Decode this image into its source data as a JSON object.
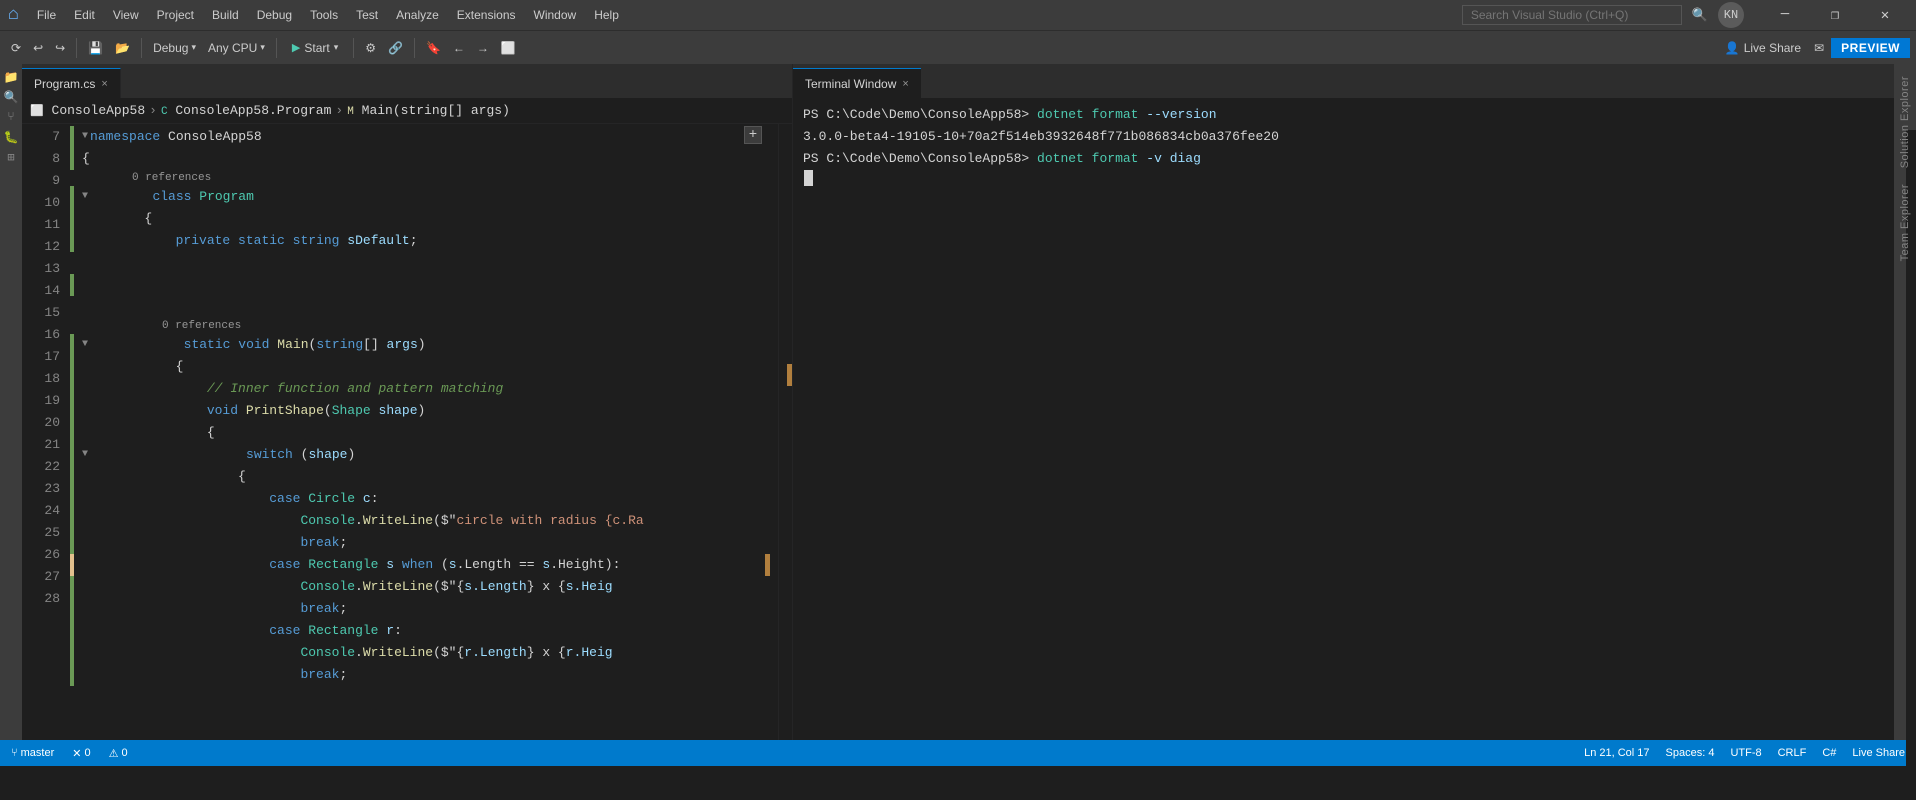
{
  "titlebar": {
    "logo": "⌂",
    "menu_items": [
      "File",
      "Edit",
      "View",
      "Project",
      "Build",
      "Debug",
      "Tools",
      "Test",
      "Analyze",
      "Extensions",
      "Window",
      "Help"
    ],
    "search_placeholder": "Search Visual Studio (Ctrl+Q)",
    "avatar_label": "KN",
    "minimize_label": "─",
    "restore_label": "❐",
    "close_label": "✕"
  },
  "toolbar": {
    "debug_label": "Debug",
    "cpu_label": "Any CPU",
    "start_label": "Start",
    "live_share_label": "Live Share",
    "preview_label": "PREVIEW"
  },
  "editor_tab": {
    "label": "Program.cs",
    "close_label": "×"
  },
  "breadcrumb": {
    "project": "ConsoleApp58",
    "class": "ConsoleApp58.Program",
    "method": "Main(string[] args)"
  },
  "code_lines": [
    {
      "num": "7",
      "indent": 0,
      "fold": "▼",
      "content": "namespace ConsoleApp58",
      "tokens": [
        {
          "t": "kw",
          "v": "namespace"
        },
        {
          "t": "plain",
          "v": " ConsoleApp58"
        }
      ],
      "lm": "green"
    },
    {
      "num": "8",
      "indent": 0,
      "fold": null,
      "content": "{",
      "tokens": [
        {
          "t": "plain",
          "v": "{"
        }
      ],
      "lm": "green"
    },
    {
      "num": "9",
      "indent": 1,
      "fold": "▼",
      "ref": "0 references",
      "content": "        class Program",
      "tokens": [
        {
          "t": "plain",
          "v": "        "
        },
        {
          "t": "kw",
          "v": "class"
        },
        {
          "t": "plain",
          "v": " "
        },
        {
          "t": "cls",
          "v": "Program"
        }
      ],
      "lm": "green"
    },
    {
      "num": "10",
      "indent": 1,
      "fold": null,
      "content": "        {",
      "tokens": [
        {
          "t": "plain",
          "v": "        {"
        }
      ],
      "lm": "green"
    },
    {
      "num": "11",
      "indent": 2,
      "fold": null,
      "content": "            private static string sDefault;",
      "tokens": [
        {
          "t": "plain",
          "v": "            "
        },
        {
          "t": "kw",
          "v": "private"
        },
        {
          "t": "plain",
          "v": " "
        },
        {
          "t": "kw",
          "v": "static"
        },
        {
          "t": "plain",
          "v": " "
        },
        {
          "t": "kw",
          "v": "string"
        },
        {
          "t": "plain",
          "v": " "
        },
        {
          "t": "var",
          "v": "sDefault"
        },
        {
          "t": "plain",
          "v": ";"
        }
      ],
      "lm": "green"
    },
    {
      "num": "12",
      "indent": 2,
      "fold": null,
      "content": "",
      "tokens": [],
      "lm": "green"
    },
    {
      "num": "13",
      "indent": 2,
      "fold": "▼",
      "ref": "0 references",
      "content": "            static void Main(string[] args)",
      "tokens": [
        {
          "t": "plain",
          "v": "            "
        },
        {
          "t": "kw",
          "v": "static"
        },
        {
          "t": "plain",
          "v": " "
        },
        {
          "t": "kw",
          "v": "void"
        },
        {
          "t": "plain",
          "v": " "
        },
        {
          "t": "method",
          "v": "Main"
        },
        {
          "t": "plain",
          "v": "("
        },
        {
          "t": "kw",
          "v": "string"
        },
        {
          "t": "plain",
          "v": "[] "
        },
        {
          "t": "param",
          "v": "args"
        },
        {
          "t": "plain",
          "v": ")"
        }
      ],
      "lm": "green"
    },
    {
      "num": "14",
      "indent": 2,
      "fold": null,
      "content": "            {",
      "tokens": [
        {
          "t": "plain",
          "v": "            {"
        }
      ],
      "lm": "green"
    },
    {
      "num": "15",
      "indent": 3,
      "fold": null,
      "content": "                // Inner function and pattern matching",
      "tokens": [
        {
          "t": "comment",
          "v": "                // Inner function and pattern matching"
        }
      ],
      "lm": "green"
    },
    {
      "num": "16",
      "indent": 3,
      "fold": null,
      "content": "                void PrintShape(Shape shape)",
      "tokens": [
        {
          "t": "plain",
          "v": "                "
        },
        {
          "t": "kw",
          "v": "void"
        },
        {
          "t": "plain",
          "v": " "
        },
        {
          "t": "method",
          "v": "PrintShape"
        },
        {
          "t": "plain",
          "v": "("
        },
        {
          "t": "cls",
          "v": "Shape"
        },
        {
          "t": "plain",
          "v": " "
        },
        {
          "t": "param",
          "v": "shape"
        },
        {
          "t": "plain",
          "v": ")"
        }
      ],
      "lm": "green"
    },
    {
      "num": "17",
      "indent": 3,
      "fold": null,
      "content": "                {",
      "tokens": [
        {
          "t": "plain",
          "v": "                {"
        }
      ],
      "lm": "green"
    },
    {
      "num": "18",
      "indent": 4,
      "fold": "▼",
      "content": "                    switch (shape)",
      "tokens": [
        {
          "t": "plain",
          "v": "                    "
        },
        {
          "t": "kw",
          "v": "switch"
        },
        {
          "t": "plain",
          "v": " ("
        },
        {
          "t": "param",
          "v": "shape"
        },
        {
          "t": "plain",
          "v": ")"
        }
      ],
      "lm": "green"
    },
    {
      "num": "19",
      "indent": 4,
      "fold": null,
      "content": "                    {",
      "tokens": [
        {
          "t": "plain",
          "v": "                    {"
        }
      ],
      "lm": "green"
    },
    {
      "num": "20",
      "indent": 5,
      "fold": null,
      "content": "                        case Circle c:",
      "tokens": [
        {
          "t": "plain",
          "v": "                        "
        },
        {
          "t": "kw",
          "v": "case"
        },
        {
          "t": "plain",
          "v": " "
        },
        {
          "t": "cls",
          "v": "Circle"
        },
        {
          "t": "plain",
          "v": " "
        },
        {
          "t": "var",
          "v": "c"
        },
        {
          "t": "plain",
          "v": ":"
        }
      ],
      "lm": "green"
    },
    {
      "num": "21",
      "indent": 6,
      "fold": null,
      "content": "                            Console.WriteLine($\"circle with radius {c.Ra",
      "tokens": [
        {
          "t": "plain",
          "v": "                            "
        },
        {
          "t": "cls",
          "v": "Console"
        },
        {
          "t": "plain",
          "v": "."
        },
        {
          "t": "method",
          "v": "WriteLine"
        },
        {
          "t": "plain",
          "v": "($\""
        },
        {
          "t": "str",
          "v": "circle with radius {c.Ra"
        }
      ],
      "lm": "green"
    },
    {
      "num": "22",
      "indent": 6,
      "fold": null,
      "content": "                            break;",
      "tokens": [
        {
          "t": "plain",
          "v": "                            "
        },
        {
          "t": "kw",
          "v": "break"
        },
        {
          "t": "plain",
          "v": ";"
        }
      ],
      "lm": "green"
    },
    {
      "num": "23",
      "indent": 5,
      "fold": null,
      "content": "                        case Rectangle s when (s.Length == s.Height):",
      "tokens": [
        {
          "t": "plain",
          "v": "                        "
        },
        {
          "t": "kw",
          "v": "case"
        },
        {
          "t": "plain",
          "v": " "
        },
        {
          "t": "cls",
          "v": "Rectangle"
        },
        {
          "t": "plain",
          "v": " "
        },
        {
          "t": "var",
          "v": "s"
        },
        {
          "t": "plain",
          "v": " "
        },
        {
          "t": "kw",
          "v": "when"
        },
        {
          "t": "plain",
          "v": " ("
        },
        {
          "t": "var",
          "v": "s"
        },
        {
          "t": "plain",
          "v": ".Length == "
        },
        {
          "t": "var",
          "v": "s"
        },
        {
          "t": "plain",
          "v": ".Height):"
        }
      ],
      "lm": "yellow"
    },
    {
      "num": "24",
      "indent": 6,
      "fold": null,
      "content": "                            Console.WriteLine($\"{s.Length} x {s.Heig",
      "tokens": [
        {
          "t": "plain",
          "v": "                            "
        },
        {
          "t": "cls",
          "v": "Console"
        },
        {
          "t": "plain",
          "v": "."
        },
        {
          "t": "method",
          "v": "WriteLine"
        },
        {
          "t": "plain",
          "v": "($\"{"
        },
        {
          "t": "var",
          "v": "s.Length"
        },
        {
          "t": "plain",
          "v": "} x {"
        },
        {
          "t": "var",
          "v": "s.Heig"
        }
      ],
      "lm": "green"
    },
    {
      "num": "25",
      "indent": 6,
      "fold": null,
      "content": "                            break;",
      "tokens": [
        {
          "t": "plain",
          "v": "                            "
        },
        {
          "t": "kw",
          "v": "break"
        },
        {
          "t": "plain",
          "v": ";"
        }
      ],
      "lm": "green"
    },
    {
      "num": "26",
      "indent": 5,
      "fold": null,
      "content": "                        case Rectangle r:",
      "tokens": [
        {
          "t": "plain",
          "v": "                        "
        },
        {
          "t": "kw",
          "v": "case"
        },
        {
          "t": "plain",
          "v": " "
        },
        {
          "t": "cls",
          "v": "Rectangle"
        },
        {
          "t": "plain",
          "v": " "
        },
        {
          "t": "var",
          "v": "r"
        },
        {
          "t": "plain",
          "v": ":"
        }
      ],
      "lm": "green"
    },
    {
      "num": "27",
      "indent": 6,
      "fold": null,
      "content": "                            Console.WriteLine($\"{r.Length} x {r.Heig",
      "tokens": [
        {
          "t": "plain",
          "v": "                            "
        },
        {
          "t": "cls",
          "v": "Console"
        },
        {
          "t": "plain",
          "v": "."
        },
        {
          "t": "method",
          "v": "WriteLine"
        },
        {
          "t": "plain",
          "v": "($\"{"
        },
        {
          "t": "var",
          "v": "r.Length"
        },
        {
          "t": "plain",
          "v": "} x {"
        },
        {
          "t": "var",
          "v": "r.Heig"
        }
      ],
      "lm": "green"
    },
    {
      "num": "28",
      "indent": 6,
      "fold": null,
      "content": "                            break;",
      "tokens": [
        {
          "t": "plain",
          "v": "                            "
        },
        {
          "t": "kw",
          "v": "break"
        },
        {
          "t": "plain",
          "v": ";"
        }
      ],
      "lm": "green"
    }
  ],
  "terminal": {
    "tab_label": "Terminal Window",
    "close_label": "×",
    "lines": [
      {
        "prompt": "PS C:\\Code\\Demo\\ConsoleApp58> ",
        "command": "dotnet format --version"
      },
      {
        "output": "3.0.0-beta4-19105-10+70a2f514eb3932648f771b086834cb0a376fee20"
      },
      {
        "prompt": "PS C:\\Code\\Demo\\ConsoleApp58> ",
        "command": "dotnet format -v diag"
      }
    ]
  },
  "statusbar": {
    "git_branch": "master",
    "errors": "0",
    "warnings": "0",
    "right_items": [
      "Ln 21, Col 17",
      "Spaces: 4",
      "UTF-8",
      "CRLF",
      "C#",
      "Live Share"
    ]
  }
}
